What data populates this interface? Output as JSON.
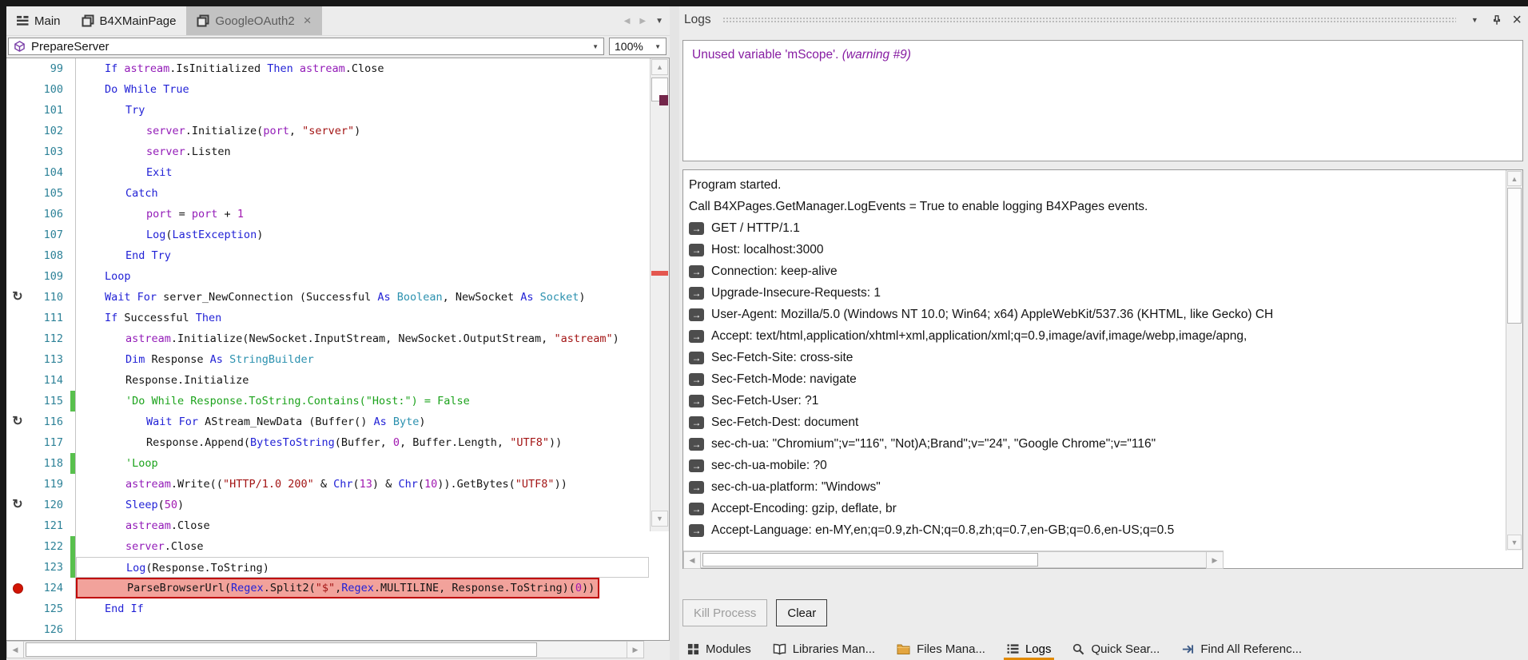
{
  "colors": {
    "accent_orange": "#e18a00",
    "breakpoint_red": "#d21404",
    "breakpoint_line_bg": "#f2a29b",
    "breakpoint_line_border": "#c00000",
    "warning_purple": "#861ca2",
    "line_number_teal": "#2d8298",
    "changed_line_green": "#58c04d",
    "keyword_blue": "#2222d6",
    "type_teal": "#2b91af",
    "string_red": "#a31515",
    "comment_green": "#1ca31c",
    "global_purple": "#931cb8"
  },
  "editor": {
    "tabs": [
      {
        "label": "Main",
        "icon": "module-icon",
        "active": false,
        "closable": false
      },
      {
        "label": "B4XMainPage",
        "icon": "page-icon",
        "active": false,
        "closable": false
      },
      {
        "label": "GoogleOAuth2",
        "icon": "page-icon",
        "active": true,
        "closable": true
      }
    ],
    "toolbar": {
      "sub_selector": "PrepareServer",
      "zoom": "100%"
    },
    "code_lines": [
      {
        "n": 99,
        "indent": 1,
        "toks": [
          [
            "k",
            "If "
          ],
          [
            "g",
            "astream"
          ],
          [
            "p",
            ".IsInitialized "
          ],
          [
            "k",
            "Then "
          ],
          [
            "g",
            "astream"
          ],
          [
            "p",
            ".Close"
          ]
        ]
      },
      {
        "n": 100,
        "indent": 1,
        "toks": [
          [
            "k",
            "Do While True"
          ]
        ]
      },
      {
        "n": 101,
        "indent": 2,
        "toks": [
          [
            "k",
            "Try"
          ]
        ]
      },
      {
        "n": 102,
        "indent": 3,
        "toks": [
          [
            "g",
            "server"
          ],
          [
            "p",
            ".Initialize("
          ],
          [
            "g",
            "port"
          ],
          [
            "p",
            ", "
          ],
          [
            "s",
            "\"server\""
          ],
          [
            "p",
            ")"
          ]
        ]
      },
      {
        "n": 103,
        "indent": 3,
        "toks": [
          [
            "g",
            "server"
          ],
          [
            "p",
            ".Listen"
          ]
        ]
      },
      {
        "n": 104,
        "indent": 3,
        "toks": [
          [
            "k",
            "Exit"
          ]
        ]
      },
      {
        "n": 105,
        "indent": 2,
        "toks": [
          [
            "k",
            "Catch"
          ]
        ]
      },
      {
        "n": 106,
        "indent": 3,
        "toks": [
          [
            "g",
            "port"
          ],
          [
            "p",
            " = "
          ],
          [
            "g",
            "port"
          ],
          [
            "p",
            " + "
          ],
          [
            "n",
            "1"
          ]
        ]
      },
      {
        "n": 107,
        "indent": 3,
        "toks": [
          [
            "k",
            "Log"
          ],
          [
            "p",
            "("
          ],
          [
            "k",
            "LastException"
          ],
          [
            "p",
            ")"
          ]
        ]
      },
      {
        "n": 108,
        "indent": 2,
        "toks": [
          [
            "k",
            "End Try"
          ]
        ]
      },
      {
        "n": 109,
        "indent": 1,
        "toks": [
          [
            "k",
            "Loop"
          ]
        ]
      },
      {
        "n": 110,
        "indent": 1,
        "resume": true,
        "toks": [
          [
            "k",
            "Wait For "
          ],
          [
            "p",
            "server_NewConnection (Successful "
          ],
          [
            "k",
            "As "
          ],
          [
            "t",
            "Boolean"
          ],
          [
            "p",
            ", NewSocket "
          ],
          [
            "k",
            "As "
          ],
          [
            "t",
            "Socket"
          ],
          [
            "p",
            ")"
          ]
        ]
      },
      {
        "n": 111,
        "indent": 1,
        "toks": [
          [
            "k",
            "If "
          ],
          [
            "p",
            "Successful "
          ],
          [
            "k",
            "Then"
          ]
        ]
      },
      {
        "n": 112,
        "indent": 2,
        "toks": [
          [
            "g",
            "astream"
          ],
          [
            "p",
            ".Initialize(NewSocket.InputStream, NewSocket.OutputStream, "
          ],
          [
            "s",
            "\"astream\""
          ],
          [
            "p",
            ")"
          ]
        ]
      },
      {
        "n": 113,
        "indent": 2,
        "toks": [
          [
            "k",
            "Dim "
          ],
          [
            "p",
            "Response "
          ],
          [
            "k",
            "As "
          ],
          [
            "t",
            "StringBuilder"
          ]
        ]
      },
      {
        "n": 114,
        "indent": 2,
        "toks": [
          [
            "p",
            "Response.Initialize"
          ]
        ]
      },
      {
        "n": 115,
        "indent": 2,
        "bar": true,
        "toks": [
          [
            "c",
            "'Do While Response.ToString.Contains(\"Host:\") = False"
          ]
        ]
      },
      {
        "n": 116,
        "indent": 3,
        "resume": true,
        "toks": [
          [
            "k",
            "Wait For "
          ],
          [
            "p",
            "AStream_NewData (Buffer() "
          ],
          [
            "k",
            "As "
          ],
          [
            "t",
            "Byte"
          ],
          [
            "p",
            ")"
          ]
        ]
      },
      {
        "n": 117,
        "indent": 3,
        "toks": [
          [
            "p",
            "Response.Append("
          ],
          [
            "k",
            "BytesToString"
          ],
          [
            "p",
            "(Buffer, "
          ],
          [
            "n",
            "0"
          ],
          [
            "p",
            ", Buffer.Length, "
          ],
          [
            "s",
            "\"UTF8\""
          ],
          [
            "p",
            "))"
          ]
        ]
      },
      {
        "n": 118,
        "indent": 2,
        "bar": true,
        "toks": [
          [
            "c",
            "'Loop"
          ]
        ]
      },
      {
        "n": 119,
        "indent": 2,
        "toks": [
          [
            "g",
            "astream"
          ],
          [
            "p",
            ".Write(("
          ],
          [
            "s",
            "\"HTTP/1.0 200\""
          ],
          [
            "p",
            " & "
          ],
          [
            "k",
            "Chr"
          ],
          [
            "p",
            "("
          ],
          [
            "n",
            "13"
          ],
          [
            "p",
            ") & "
          ],
          [
            "k",
            "Chr"
          ],
          [
            "p",
            "("
          ],
          [
            "n",
            "10"
          ],
          [
            "p",
            ")).GetBytes("
          ],
          [
            "s",
            "\"UTF8\""
          ],
          [
            "p",
            "))"
          ]
        ]
      },
      {
        "n": 120,
        "indent": 2,
        "resume": true,
        "toks": [
          [
            "k",
            "Sleep"
          ],
          [
            "p",
            "("
          ],
          [
            "n",
            "50"
          ],
          [
            "p",
            ")"
          ]
        ]
      },
      {
        "n": 121,
        "indent": 2,
        "toks": [
          [
            "g",
            "astream"
          ],
          [
            "p",
            ".Close"
          ]
        ]
      },
      {
        "n": 122,
        "indent": 2,
        "bar": true,
        "toks": [
          [
            "g",
            "server"
          ],
          [
            "p",
            ".Close"
          ]
        ]
      },
      {
        "n": 123,
        "indent": 2,
        "bar": true,
        "cur": true,
        "toks": [
          [
            "k",
            "Log"
          ],
          [
            "p",
            "(Response.ToString)"
          ]
        ]
      },
      {
        "n": 124,
        "indent": 2,
        "bp": true,
        "hl": true,
        "toks": [
          [
            "p",
            "ParseBrowserUrl("
          ],
          [
            "k",
            "Regex"
          ],
          [
            "p",
            ".Split2("
          ],
          [
            "s",
            "\"$\""
          ],
          [
            "p",
            ","
          ],
          [
            "k",
            "Regex"
          ],
          [
            "p",
            ".MULTILINE, Response.ToString)("
          ],
          [
            "n",
            "0"
          ],
          [
            "p",
            "))"
          ]
        ]
      },
      {
        "n": 125,
        "indent": 1,
        "toks": [
          [
            "k",
            "End If"
          ]
        ]
      },
      {
        "n": 126,
        "indent": 0,
        "toks": []
      }
    ]
  },
  "logs": {
    "title": "Logs",
    "warning": {
      "text": "Unused variable 'mScope'. ",
      "suffix": "(warning #9)"
    },
    "log_lines": [
      {
        "icon": false,
        "text": "Program started."
      },
      {
        "icon": false,
        "text": "Call B4XPages.GetManager.LogEvents = True to enable logging B4XPages events."
      },
      {
        "icon": true,
        "text": "GET / HTTP/1.1"
      },
      {
        "icon": true,
        "text": "Host: localhost:3000"
      },
      {
        "icon": true,
        "text": "Connection: keep-alive"
      },
      {
        "icon": true,
        "text": "Upgrade-Insecure-Requests: 1"
      },
      {
        "icon": true,
        "text": "User-Agent: Mozilla/5.0 (Windows NT 10.0; Win64; x64) AppleWebKit/537.36 (KHTML, like Gecko) CH"
      },
      {
        "icon": true,
        "text": "Accept: text/html,application/xhtml+xml,application/xml;q=0.9,image/avif,image/webp,image/apng,"
      },
      {
        "icon": true,
        "text": "Sec-Fetch-Site: cross-site"
      },
      {
        "icon": true,
        "text": "Sec-Fetch-Mode: navigate"
      },
      {
        "icon": true,
        "text": "Sec-Fetch-User: ?1"
      },
      {
        "icon": true,
        "text": "Sec-Fetch-Dest: document"
      },
      {
        "icon": true,
        "text": "sec-ch-ua: \"Chromium\";v=\"116\", \"Not)A;Brand\";v=\"24\", \"Google Chrome\";v=\"116\""
      },
      {
        "icon": true,
        "text": "sec-ch-ua-mobile: ?0"
      },
      {
        "icon": true,
        "text": "sec-ch-ua-platform: \"Windows\""
      },
      {
        "icon": true,
        "text": "Accept-Encoding: gzip, deflate, br"
      },
      {
        "icon": true,
        "text": "Accept-Language: en-MY,en;q=0.9,zh-CN;q=0.8,zh;q=0.7,en-GB;q=0.6,en-US;q=0.5"
      }
    ],
    "buttons": [
      {
        "label": "Kill Process",
        "disabled": true,
        "default": false
      },
      {
        "label": "Clear",
        "disabled": false,
        "default": true
      }
    ],
    "bottom_tabs": [
      {
        "label": "Modules",
        "icon": "modules-icon",
        "active": false
      },
      {
        "label": "Libraries Man...",
        "icon": "book-icon",
        "active": false
      },
      {
        "label": "Files Mana...",
        "icon": "folder-icon",
        "active": false
      },
      {
        "label": "Logs",
        "icon": "logs-icon",
        "active": true
      },
      {
        "label": "Quick Sear...",
        "icon": "search-icon",
        "active": false
      },
      {
        "label": "Find All Referenc...",
        "icon": "references-icon",
        "active": false
      }
    ]
  }
}
